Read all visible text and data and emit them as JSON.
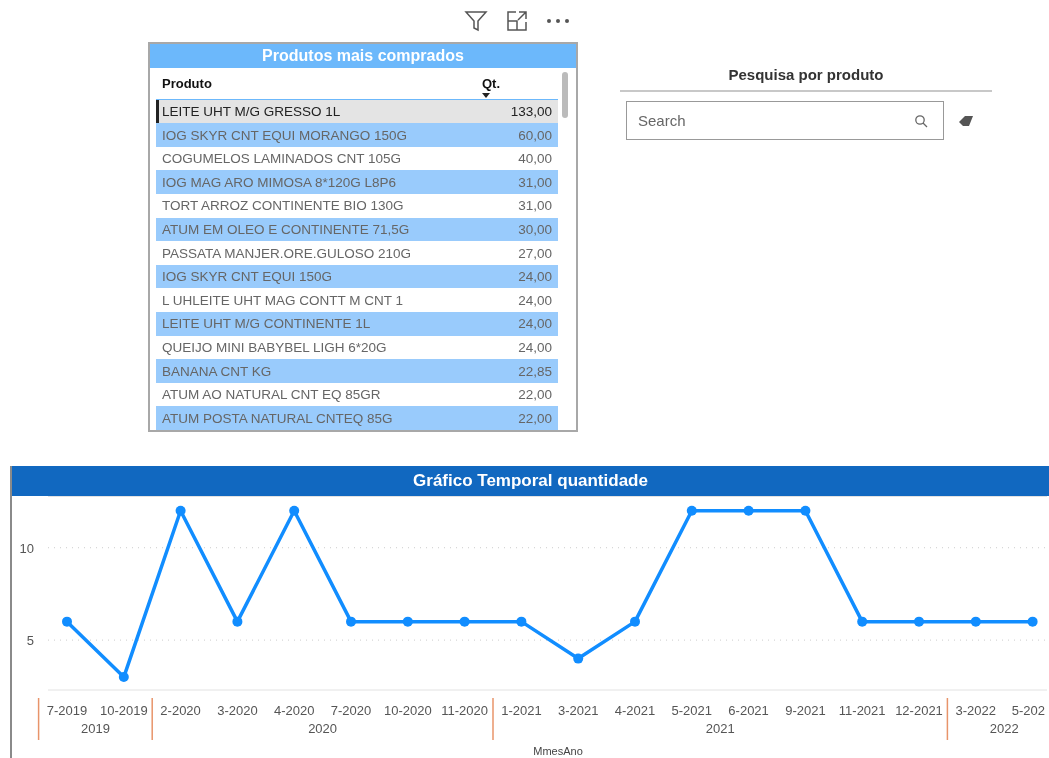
{
  "table_visual": {
    "title": "Produtos mais comprados",
    "columns": [
      {
        "label": "Produto",
        "sorted": false
      },
      {
        "label": "Qt.",
        "sorted": true,
        "descending": true
      }
    ],
    "rows": [
      {
        "produto": "LEITE UHT M/G GRESSO 1L",
        "qt": "133,00",
        "selected": true
      },
      {
        "produto": "IOG SKYR CNT EQUI MORANGO 150G",
        "qt": "60,00",
        "selected": false
      },
      {
        "produto": "COGUMELOS LAMINADOS CNT 105G",
        "qt": "40,00",
        "selected": false
      },
      {
        "produto": "IOG MAG ARO MIMOSA 8*120G L8P6",
        "qt": "31,00",
        "selected": false
      },
      {
        "produto": "TORT ARROZ CONTINENTE BIO 130G",
        "qt": "31,00",
        "selected": false
      },
      {
        "produto": "ATUM EM OLEO E CONTINENTE 71,5G",
        "qt": "30,00",
        "selected": false
      },
      {
        "produto": "PASSATA MANJER.ORE.GULOSO 210G",
        "qt": "27,00",
        "selected": false
      },
      {
        "produto": "IOG SKYR CNT EQUI 150G",
        "qt": "24,00",
        "selected": false
      },
      {
        "produto": "L UHLEITE UHT MAG CONTT M CNT 1",
        "qt": "24,00",
        "selected": false
      },
      {
        "produto": "LEITE UHT M/G CONTINENTE 1L",
        "qt": "24,00",
        "selected": false
      },
      {
        "produto": "QUEIJO MINI BABYBEL LIGH 6*20G",
        "qt": "24,00",
        "selected": false
      },
      {
        "produto": "BANANA CNT KG",
        "qt": "22,85",
        "selected": false
      },
      {
        "produto": "ATUM AO NATURAL CNT EQ 85GR",
        "qt": "22,00",
        "selected": false
      },
      {
        "produto": "ATUM POSTA NATURAL CNTEQ 85G",
        "qt": "22,00",
        "selected": false
      }
    ]
  },
  "search_slicer": {
    "title": "Pesquisa por produto",
    "placeholder": "Search"
  },
  "chart_panel": {
    "title": "Gráfico Temporal quantidade",
    "chart_data": {
      "type": "line",
      "xlabel": "MmesAno",
      "categories": [
        "7-2019",
        "10-2019",
        "2-2020",
        "3-2020",
        "4-2020",
        "7-2020",
        "10-2020",
        "11-2020",
        "1-2021",
        "3-2021",
        "4-2021",
        "5-2021",
        "6-2021",
        "9-2021",
        "11-2021",
        "12-2021",
        "3-2022",
        "5-202"
      ],
      "series": [
        {
          "color": "#118dff",
          "marker": "circle",
          "values": [
            6,
            3,
            12,
            6,
            12,
            6,
            6,
            6,
            6,
            4,
            6,
            12,
            12,
            12,
            6,
            6,
            6,
            6
          ]
        }
      ],
      "ylim": [
        2.3,
        12.8
      ],
      "yticks": [
        5,
        10
      ]
    },
    "x_groups": [
      {
        "label": "2019"
      },
      {
        "label": "2020"
      },
      {
        "label": "2021"
      },
      {
        "label": "2022"
      }
    ]
  }
}
